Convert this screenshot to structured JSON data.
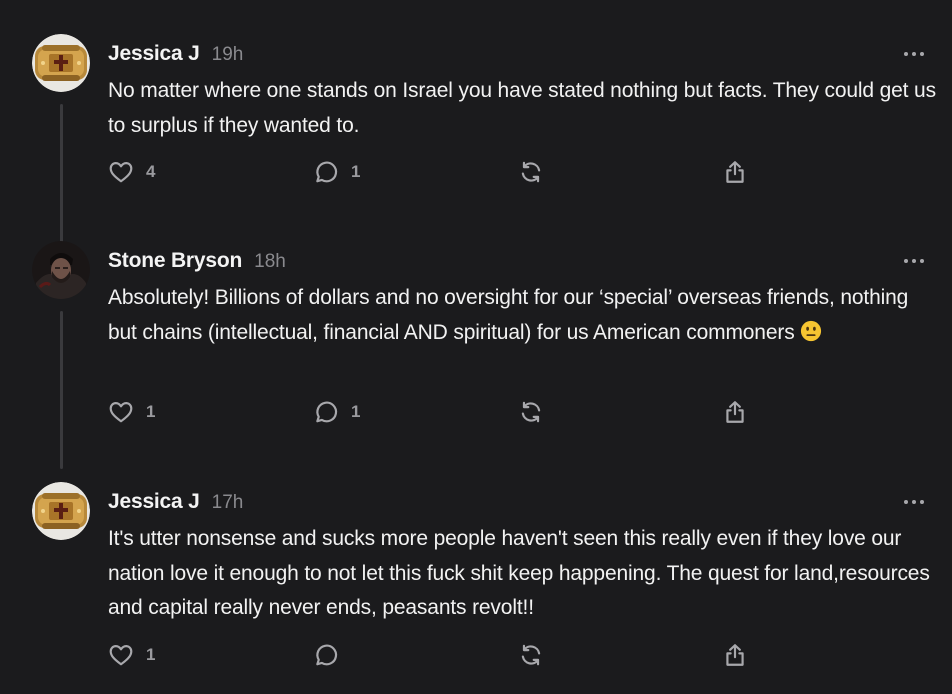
{
  "comments": [
    {
      "author": "Jessica J",
      "time": "19h",
      "text": "No matter where one stands on Israel you have stated nothing but facts. They could get us to surplus if they wanted to.",
      "likes": "4",
      "replies": "1",
      "avatar_icon": "cross-ring-icon"
    },
    {
      "author": "Stone Bryson",
      "time": "18h",
      "text": "Absolutely! Billions of dollars and no oversight for our ‘special’ overseas friends, nothing but chains (intellectual, financial AND spiritual) for us American commoners",
      "emoji": "neutral-face-emoji",
      "likes": "1",
      "replies": "1",
      "avatar_icon": "person-photo-icon"
    },
    {
      "author": "Jessica J",
      "time": "17h",
      "text": "It's utter nonsense and sucks more people haven't seen this really even if they love our nation love it enough to not let this fuck shit keep happening. The quest for land,resources and capital really never ends, peasants revolt!!",
      "likes": "1",
      "replies": "",
      "avatar_icon": "cross-ring-icon"
    }
  ],
  "icons": {
    "more": "more-horizontal-icon",
    "like": "heart-icon",
    "reply": "comment-bubble-icon",
    "restack": "restack-icon",
    "share": "share-icon"
  },
  "colors": {
    "background": "#1b1b1d",
    "text": "#f2f2f2",
    "muted": "#8a8a8e",
    "icon": "#a8a8ac",
    "thread_line": "#3a3a3d"
  }
}
